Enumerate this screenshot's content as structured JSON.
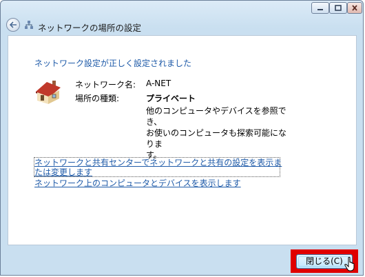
{
  "window": {
    "title": "ネットワークの場所の設定",
    "controls": {
      "minimize": "minimize-icon",
      "maximize": "maximize-icon",
      "close": "close-icon"
    }
  },
  "content": {
    "heading": "ネットワーク設定が正しく設定されました",
    "network_name_label": "ネットワーク名:",
    "network_name_value": "A-NET",
    "location_type_label": "場所の種類:",
    "location_type_value": "プライベート",
    "description_line1": "他のコンピュータやデバイスを参照でき、",
    "description_line2": "お使いのコンピュータも探索可能になりま",
    "description_line3": "す。",
    "link_sharing_center": "ネットワークと共有センターでネットワークと共有の設定を表示または変更します",
    "link_view_computers": "ネットワーク上のコンピュータとデバイスを表示します"
  },
  "footer": {
    "close_button_label": "閉じる(C)"
  },
  "colors": {
    "link": "#1e5aa8",
    "highlight": "#e00000"
  }
}
